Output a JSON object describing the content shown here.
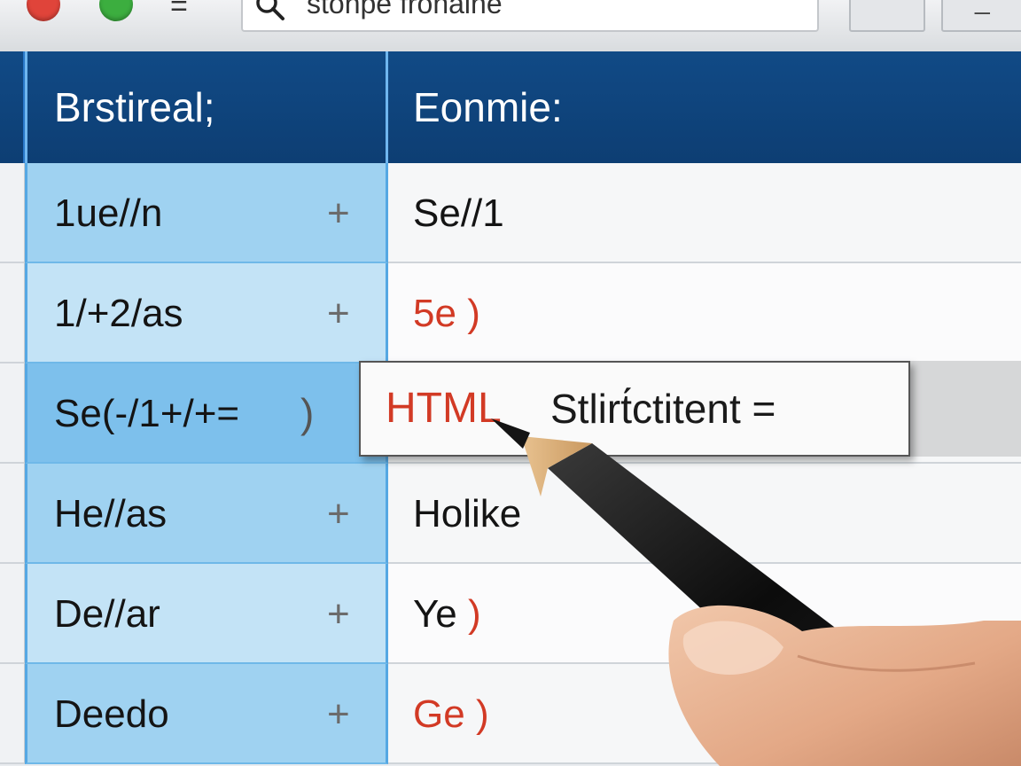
{
  "toolbar": {
    "search_text": "stonpe fronaine",
    "menu_icon": "menu-icon",
    "search_icon": "search-icon"
  },
  "table": {
    "headers": [
      "Brstireal;",
      "Eonmie:"
    ],
    "rows": [
      {
        "name": "1ue//n",
        "value": "Se//1",
        "value_color": "dark"
      },
      {
        "name": "1/+2/as",
        "value": "5e",
        "value_color": "red"
      },
      {
        "name": "Se(-/1+/+=",
        "value": "",
        "value_color": "dark"
      },
      {
        "name": "He//as",
        "value": "Holike",
        "value_color": "dark"
      },
      {
        "name": "De//ar",
        "value": "Ye",
        "value_color": "dark"
      },
      {
        "name": "Deedo",
        "value": "Ge",
        "value_color": "red"
      }
    ],
    "plus_symbol": "+",
    "paren_symbol": ")"
  },
  "editor": {
    "tag": "HTML",
    "text": "Stlirt́ctitent ="
  },
  "colors": {
    "header_bg": "#0d3e73",
    "selected_column": "#9fd2f1",
    "accent_red": "#d23a25"
  }
}
